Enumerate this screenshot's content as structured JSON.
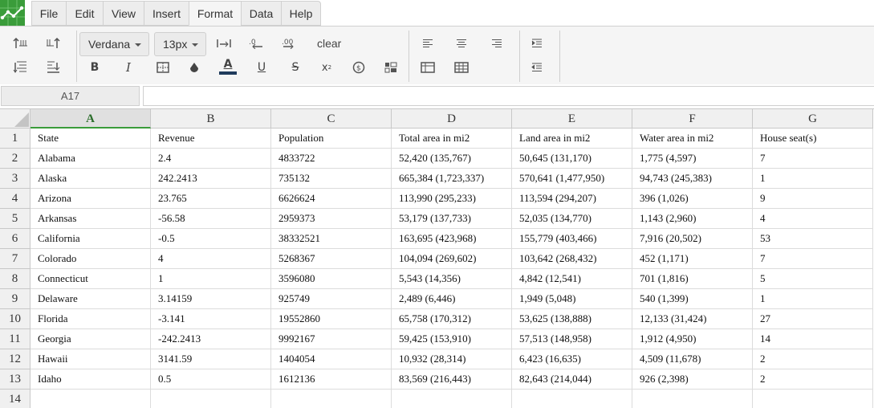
{
  "menu": {
    "items": [
      "File",
      "Edit",
      "View",
      "Insert",
      "Format",
      "Data",
      "Help"
    ],
    "active": "Format"
  },
  "toolbar": {
    "font_family": "Verdana",
    "font_size": "13px",
    "clear_label": "clear",
    "icons": [
      "indent-top-icon",
      "valign-top-icon",
      "text-direction-icon",
      "decrease-decimal-icon",
      "increase-decimal-icon",
      "align-middle-icon",
      "align-bottom-icon",
      "bold-icon",
      "italic-icon",
      "borders-icon",
      "fill-color-icon",
      "text-color-icon",
      "underline-icon",
      "strikethrough-icon",
      "superscript-icon",
      "currency-icon",
      "format-icon",
      "align-left-icon",
      "align-center-icon",
      "align-right-icon",
      "table-icon",
      "grid-icon",
      "indent-increase-icon",
      "indent-decrease-icon"
    ],
    "accent_color": "#3a9c3a",
    "text_color_swatch": "#1f3b5c"
  },
  "formula_bar": {
    "cell_ref": "A17",
    "value": ""
  },
  "sheet": {
    "columns": [
      "A",
      "B",
      "C",
      "D",
      "E",
      "F",
      "G"
    ],
    "selected_column": "A",
    "rows": [
      {
        "num": "1",
        "cells": [
          "State",
          "Revenue",
          "Population",
          "Total area in mi2",
          "Land area in mi2",
          "Water area in mi2",
          "House seat(s)"
        ]
      },
      {
        "num": "2",
        "cells": [
          "Alabama",
          "2.4",
          "4833722",
          "52,420 (135,767)",
          "50,645 (131,170)",
          "1,775 (4,597)",
          "7"
        ]
      },
      {
        "num": "3",
        "cells": [
          "Alaska",
          "242.2413",
          "735132",
          "665,384 (1,723,337)",
          "570,641 (1,477,950)",
          "94,743 (245,383)",
          "1"
        ]
      },
      {
        "num": "4",
        "cells": [
          "Arizona",
          "23.765",
          "6626624",
          "113,990 (295,233)",
          "113,594 (294,207)",
          "396 (1,026)",
          "9"
        ]
      },
      {
        "num": "5",
        "cells": [
          "Arkansas",
          "-56.58",
          "2959373",
          "53,179 (137,733)",
          "52,035 (134,770)",
          "1,143 (2,960)",
          "4"
        ]
      },
      {
        "num": "6",
        "cells": [
          "California",
          "-0.5",
          "38332521",
          "163,695 (423,968)",
          "155,779 (403,466)",
          "7,916 (20,502)",
          "53"
        ]
      },
      {
        "num": "7",
        "cells": [
          "Colorado",
          "4",
          "5268367",
          "104,094 (269,602)",
          "103,642 (268,432)",
          "452 (1,171)",
          "7"
        ]
      },
      {
        "num": "8",
        "cells": [
          "Connecticut",
          "1",
          "3596080",
          "5,543 (14,356)",
          "4,842 (12,541)",
          "701 (1,816)",
          "5"
        ]
      },
      {
        "num": "9",
        "cells": [
          "Delaware",
          "3.14159",
          "925749",
          "2,489 (6,446)",
          "1,949 (5,048)",
          "540 (1,399)",
          "1"
        ]
      },
      {
        "num": "10",
        "cells": [
          "Florida",
          "-3.141",
          "19552860",
          "65,758 (170,312)",
          "53,625 (138,888)",
          "12,133 (31,424)",
          "27"
        ]
      },
      {
        "num": "11",
        "cells": [
          "Georgia",
          "-242.2413",
          "9992167",
          "59,425 (153,910)",
          "57,513 (148,958)",
          "1,912 (4,950)",
          "14"
        ]
      },
      {
        "num": "12",
        "cells": [
          "Hawaii",
          "3141.59",
          "1404054",
          "10,932 (28,314)",
          "6,423 (16,635)",
          "4,509 (11,678)",
          "2"
        ]
      },
      {
        "num": "13",
        "cells": [
          "Idaho",
          "0.5",
          "1612136",
          "83,569 (216,443)",
          "82,643 (214,044)",
          "926 (2,398)",
          "2"
        ]
      },
      {
        "num": "14",
        "cells": [
          "",
          "",
          "",
          "",
          "",
          "",
          ""
        ]
      }
    ]
  }
}
